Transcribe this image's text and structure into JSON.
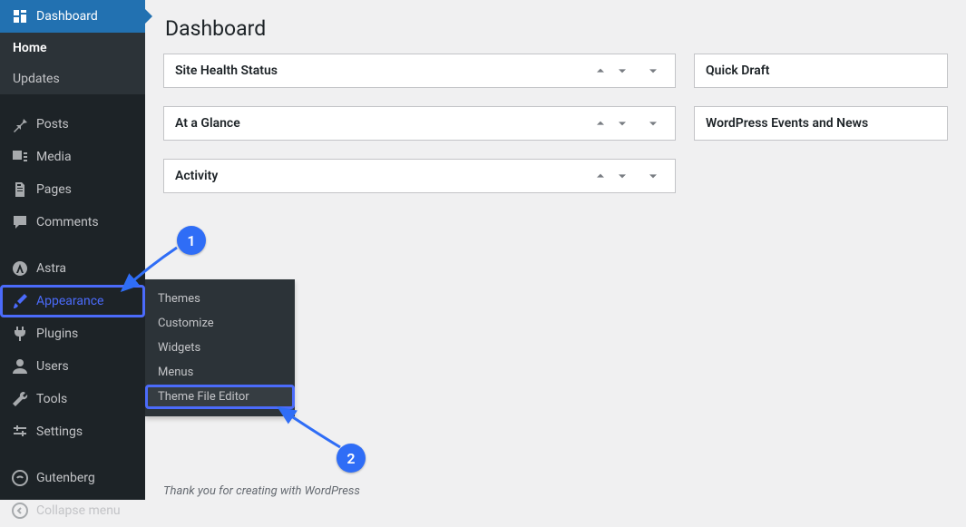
{
  "sidebar": {
    "dashboard": "Dashboard",
    "home": "Home",
    "updates": "Updates",
    "posts": "Posts",
    "media": "Media",
    "pages": "Pages",
    "comments": "Comments",
    "astra": "Astra",
    "appearance": "Appearance",
    "plugins": "Plugins",
    "users": "Users",
    "tools": "Tools",
    "settings": "Settings",
    "gutenberg": "Gutenberg",
    "collapse": "Collapse menu"
  },
  "flyout": {
    "themes": "Themes",
    "customize": "Customize",
    "widgets": "Widgets",
    "menus": "Menus",
    "editor": "Theme File Editor"
  },
  "title": "Dashboard",
  "boxes": {
    "sitehealth": "Site Health Status",
    "ataglance": "At a Glance",
    "activity": "Activity",
    "quickdraft": "Quick Draft",
    "events": "WordPress Events and News"
  },
  "annotations": {
    "one": "1",
    "two": "2"
  },
  "footer": "Thank you for creating with WordPress"
}
